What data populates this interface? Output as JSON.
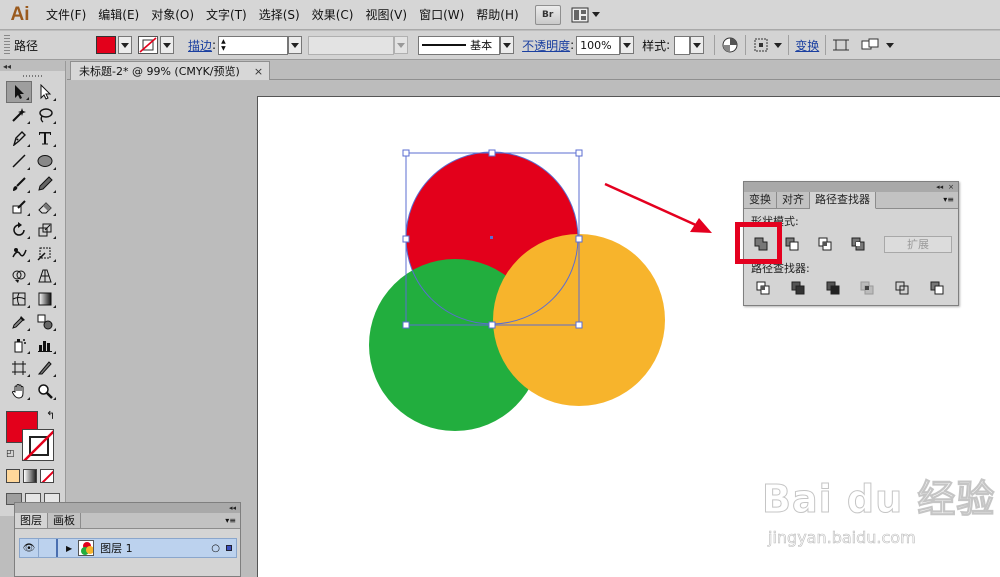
{
  "app": {
    "logo": "Ai"
  },
  "menu": [
    "文件(F)",
    "编辑(E)",
    "对象(O)",
    "文字(T)",
    "选择(S)",
    "效果(C)",
    "视图(V)",
    "窗口(W)",
    "帮助(H)"
  ],
  "menubar_buttons": {
    "bridge": "Br"
  },
  "control_bar": {
    "selection_type": "路径",
    "stroke_label": "描边",
    "brush_label": "基本",
    "opacity_label": "不透明度",
    "opacity_value": "100%",
    "style_label": "样式",
    "transform_label": "变换",
    "fill_color": "#e3001b"
  },
  "document": {
    "tab_title": "未标题-2* @ 99% (CMYK/预览)",
    "close_glyph": "×"
  },
  "art": {
    "red": "#e3001b",
    "green": "#22ae3e",
    "orange": "#f7b42c",
    "selection": "#5b6dd1",
    "arrow": "#e4001f"
  },
  "pathfinder": {
    "tabs": [
      "变换",
      "对齐",
      "路径查找器"
    ],
    "shape_modes_label": "形状模式:",
    "pathfinders_label": "路径查找器:",
    "expand_label": "扩展"
  },
  "layers": {
    "tabs": [
      "图层",
      "画板"
    ],
    "layer_name": "图层 1"
  },
  "watermark": {
    "brand": "Bai du 经验",
    "url": "jingyan.baidu.com"
  }
}
